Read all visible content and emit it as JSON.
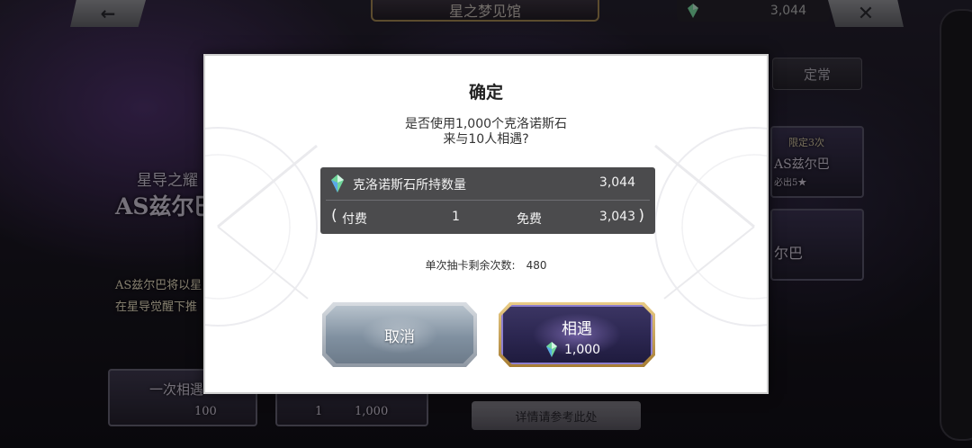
{
  "background": {
    "header": {
      "back_icon": "left-arrow-icon",
      "title": "星之梦见馆",
      "currency_icon": "chronos-stone-icon",
      "currency_value": "3,044",
      "close_icon": "close-x-icon"
    },
    "tab_regular": "定常",
    "banner": {
      "subtitle": "星导之耀",
      "title": "AS兹尔巴",
      "desc_line1": "AS兹尔巴将以星",
      "desc_line2": "在星导觉醒下推"
    },
    "right_cards": {
      "card1_tag": "限定3次",
      "card1_name": "AS兹尔巴",
      "card1_note": "必出5★",
      "card2_name": "尔巴"
    },
    "single_pull": {
      "label": "一次相遇",
      "cost": "100"
    },
    "ten_pull": {
      "count": "1",
      "cost": "1,000"
    },
    "details_label": "详情请参考此处"
  },
  "modal": {
    "title": "确定",
    "question_line1": "是否使用1,000个克洛诺斯石",
    "question_line2": "来与10人相遇?",
    "owned": {
      "icon": "chronos-stone-icon",
      "label": "克洛诺斯石所持数量",
      "value": "3,044"
    },
    "breakdown": {
      "open_paren": "(",
      "paid_label": "付费",
      "paid_value": "1",
      "free_label": "免费",
      "free_value": "3,043",
      "close_paren": ")"
    },
    "remaining_label": "单次抽卡剩余次数:",
    "remaining_value": "480",
    "cancel_label": "取消",
    "confirm_label": "相遇",
    "confirm_cost_icon": "chronos-stone-icon",
    "confirm_cost": "1,000"
  },
  "colors": {
    "gem_green": "#7fe3a8",
    "gem_blue": "#6aa8ff",
    "confirm_bg": "#2b2650",
    "confirm_border": "#d9b46a",
    "info_box_bg": "#4b4b4d"
  }
}
